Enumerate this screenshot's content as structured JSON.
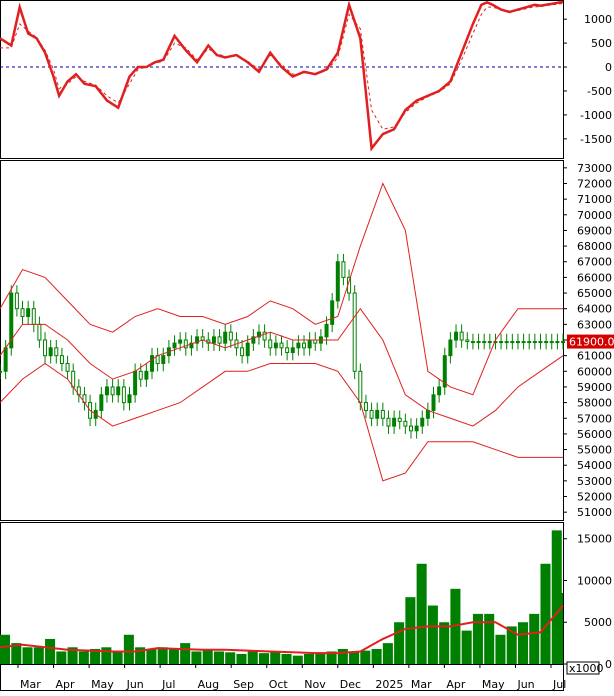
{
  "chart_data": [
    {
      "type": "line",
      "panel": "oscillator",
      "ylim": [
        -1900,
        1400
      ],
      "y_ticks": [
        1000,
        500,
        0,
        -500,
        -1000,
        -1500
      ],
      "zero_line": 0,
      "series": [
        {
          "style": "thick",
          "color": "#e02020",
          "x": [
            0,
            0.02,
            0.035,
            0.05,
            0.065,
            0.08,
            0.095,
            0.105,
            0.12,
            0.135,
            0.15,
            0.17,
            0.19,
            0.21,
            0.23,
            0.245,
            0.26,
            0.275,
            0.29,
            0.31,
            0.33,
            0.35,
            0.37,
            0.385,
            0.4,
            0.42,
            0.44,
            0.46,
            0.48,
            0.5,
            0.52,
            0.54,
            0.56,
            0.58,
            0.6,
            0.62,
            0.64,
            0.66,
            0.68,
            0.7,
            0.72,
            0.74,
            0.76,
            0.78,
            0.8,
            0.82,
            0.84,
            0.855,
            0.865,
            0.875,
            0.89,
            0.905,
            0.92,
            0.935,
            0.95,
            0.96,
            0.97,
            0.98,
            0.99,
            1.0
          ],
          "values": [
            600,
            450,
            1250,
            700,
            600,
            300,
            -200,
            -600,
            -300,
            -150,
            -350,
            -400,
            -700,
            -850,
            -200,
            0,
            0,
            100,
            150,
            650,
            350,
            100,
            450,
            250,
            200,
            250,
            100,
            -100,
            300,
            0,
            -200,
            -100,
            -150,
            -50,
            300,
            1300,
            600,
            -1700,
            -1400,
            -1300,
            -900,
            -700,
            -600,
            -500,
            -300,
            300,
            900,
            1300,
            1350,
            1300,
            1200,
            1150,
            1200,
            1250,
            1300,
            1280,
            1300,
            1320,
            1340,
            1360
          ]
        },
        {
          "style": "dashed",
          "color": "#e02020",
          "x": [
            0,
            0.02,
            0.035,
            0.05,
            0.065,
            0.08,
            0.095,
            0.105,
            0.12,
            0.135,
            0.15,
            0.17,
            0.19,
            0.21,
            0.23,
            0.245,
            0.26,
            0.275,
            0.29,
            0.31,
            0.33,
            0.35,
            0.37,
            0.385,
            0.4,
            0.42,
            0.44,
            0.46,
            0.48,
            0.5,
            0.52,
            0.54,
            0.56,
            0.58,
            0.6,
            0.62,
            0.64,
            0.66,
            0.68,
            0.7,
            0.72,
            0.74,
            0.76,
            0.78,
            0.8,
            0.82,
            0.84,
            0.855,
            0.865,
            0.875,
            0.89,
            0.905,
            0.92,
            0.935,
            0.95,
            0.96,
            0.97,
            0.98,
            0.99,
            1.0
          ],
          "values": [
            400,
            400,
            900,
            750,
            620,
            350,
            -50,
            -450,
            -350,
            -200,
            -300,
            -380,
            -600,
            -750,
            -350,
            -50,
            0,
            80,
            120,
            500,
            400,
            150,
            380,
            280,
            220,
            230,
            120,
            -50,
            250,
            50,
            -150,
            -120,
            -140,
            -80,
            200,
            1100,
            800,
            -900,
            -1300,
            -1250,
            -950,
            -750,
            -620,
            -520,
            -350,
            150,
            700,
            1100,
            1250,
            1250,
            1200,
            1170,
            1180,
            1220,
            1260,
            1260,
            1280,
            1300,
            1310,
            1330
          ]
        }
      ]
    },
    {
      "type": "candlestick",
      "panel": "price",
      "ylim": [
        50500,
        73500
      ],
      "y_ticks": [
        73000,
        72000,
        71000,
        70000,
        69000,
        68000,
        67000,
        66000,
        65000,
        64000,
        63000,
        62000,
        61000,
        60000,
        59000,
        58000,
        57000,
        56000,
        55000,
        54000,
        53000,
        52000,
        51000
      ],
      "last_price_label": "61900.00",
      "last_price": 61900,
      "series": [
        {
          "name": "close",
          "color": "#008000",
          "x": [
            0,
            0.01,
            0.02,
            0.03,
            0.04,
            0.05,
            0.06,
            0.07,
            0.08,
            0.09,
            0.1,
            0.11,
            0.12,
            0.13,
            0.14,
            0.15,
            0.16,
            0.17,
            0.18,
            0.19,
            0.2,
            0.21,
            0.22,
            0.23,
            0.24,
            0.25,
            0.26,
            0.27,
            0.28,
            0.29,
            0.3,
            0.31,
            0.32,
            0.33,
            0.34,
            0.35,
            0.36,
            0.37,
            0.38,
            0.39,
            0.4,
            0.41,
            0.42,
            0.43,
            0.44,
            0.45,
            0.46,
            0.47,
            0.48,
            0.49,
            0.5,
            0.51,
            0.52,
            0.53,
            0.54,
            0.55,
            0.56,
            0.57,
            0.58,
            0.59,
            0.6,
            0.61,
            0.62,
            0.63,
            0.64,
            0.65,
            0.66,
            0.67,
            0.68,
            0.69,
            0.7,
            0.71,
            0.72,
            0.73,
            0.74,
            0.75,
            0.76,
            0.77,
            0.78,
            0.79,
            0.8,
            0.81,
            0.82,
            0.83,
            0.84,
            0.85,
            0.86,
            0.87,
            0.88,
            0.89,
            0.9,
            0.91,
            0.92,
            0.93,
            0.94,
            0.95,
            0.96,
            0.97,
            0.98,
            0.99,
            1.0
          ],
          "values": [
            60000,
            61500,
            65000,
            64000,
            63500,
            64000,
            63000,
            62000,
            61000,
            61500,
            61000,
            60500,
            60000,
            59000,
            58500,
            58000,
            57000,
            57500,
            58500,
            59000,
            58500,
            59000,
            58000,
            58500,
            60000,
            59500,
            60000,
            61000,
            60500,
            61000,
            61500,
            61800,
            62000,
            61500,
            61800,
            62200,
            62000,
            61800,
            62200,
            61800,
            62500,
            62000,
            61500,
            61000,
            61800,
            62200,
            62500,
            62000,
            61500,
            61800,
            61500,
            61200,
            61500,
            61800,
            61500,
            62000,
            61800,
            62200,
            63000,
            64500,
            67000,
            66000,
            65000,
            60000,
            58000,
            57500,
            57000,
            57500,
            57000,
            56500,
            57000,
            56800,
            56500,
            56200,
            56500,
            57000,
            57500,
            58500,
            59000,
            61000,
            62000,
            62500,
            62000,
            61900,
            61900,
            61900,
            61900,
            61900,
            61900,
            61900,
            61900,
            61900,
            61900,
            61900,
            61900,
            61900,
            61900,
            61900,
            61900,
            61900,
            61900
          ]
        },
        {
          "name": "upper band",
          "color": "#e02020",
          "x": [
            0,
            0.04,
            0.08,
            0.12,
            0.16,
            0.2,
            0.24,
            0.28,
            0.32,
            0.36,
            0.4,
            0.44,
            0.48,
            0.52,
            0.56,
            0.6,
            0.64,
            0.68,
            0.72,
            0.76,
            0.8,
            0.84,
            0.88,
            0.92,
            0.96,
            1.0
          ],
          "values": [
            64000,
            66500,
            66000,
            64500,
            63000,
            62500,
            63500,
            64000,
            63500,
            63500,
            63000,
            63500,
            64500,
            64000,
            63000,
            63500,
            68000,
            72000,
            69000,
            60000,
            59000,
            58500,
            62000,
            64000,
            64000,
            64000
          ]
        },
        {
          "name": "lower band",
          "color": "#e02020",
          "x": [
            0,
            0.04,
            0.08,
            0.12,
            0.16,
            0.2,
            0.24,
            0.28,
            0.32,
            0.36,
            0.4,
            0.44,
            0.48,
            0.52,
            0.56,
            0.6,
            0.64,
            0.68,
            0.72,
            0.76,
            0.8,
            0.84,
            0.88,
            0.92,
            0.96,
            1.0
          ],
          "values": [
            58000,
            59500,
            60500,
            59500,
            57500,
            56500,
            57000,
            57500,
            58000,
            59000,
            60000,
            60000,
            60500,
            60500,
            60500,
            60000,
            58000,
            53000,
            53500,
            55500,
            55500,
            55500,
            55000,
            54500,
            54500,
            54500
          ]
        },
        {
          "name": "middle band",
          "color": "#e02020",
          "x": [
            0,
            0.04,
            0.08,
            0.12,
            0.16,
            0.2,
            0.24,
            0.28,
            0.32,
            0.36,
            0.4,
            0.44,
            0.48,
            0.52,
            0.56,
            0.6,
            0.64,
            0.68,
            0.72,
            0.76,
            0.8,
            0.84,
            0.88,
            0.92,
            0.96,
            1.0
          ],
          "values": [
            61000,
            63000,
            63000,
            62000,
            60500,
            59500,
            60000,
            61000,
            61500,
            62000,
            61500,
            62000,
            62500,
            62000,
            62000,
            62000,
            64000,
            62000,
            58500,
            57500,
            57000,
            56500,
            57500,
            59000,
            60000,
            61000
          ]
        }
      ]
    },
    {
      "type": "bar",
      "panel": "volume",
      "ylim": [
        0,
        17000
      ],
      "y_ticks": [
        15000,
        10000,
        5000,
        0
      ],
      "unit_label": "x1000",
      "x_tick_labels": [
        "Mar",
        "Apr",
        "May",
        "Jun",
        "Jul",
        "Aug",
        "Sep",
        "Oct",
        "Nov",
        "Dec",
        "2025",
        "Mar",
        "Apr",
        "May",
        "Jun",
        "Jul"
      ],
      "series": [
        {
          "name": "volume",
          "color": "#008000",
          "x": [
            0,
            0.02,
            0.04,
            0.06,
            0.08,
            0.1,
            0.12,
            0.14,
            0.16,
            0.18,
            0.2,
            0.22,
            0.24,
            0.26,
            0.28,
            0.3,
            0.32,
            0.34,
            0.36,
            0.38,
            0.4,
            0.42,
            0.44,
            0.46,
            0.48,
            0.5,
            0.52,
            0.54,
            0.56,
            0.58,
            0.6,
            0.62,
            0.64,
            0.66,
            0.68,
            0.7,
            0.72,
            0.74,
            0.76,
            0.78,
            0.8,
            0.82,
            0.84,
            0.86,
            0.88,
            0.9,
            0.92,
            0.94,
            0.96,
            0.98,
            1.0
          ],
          "values": [
            3500,
            2500,
            2000,
            2000,
            3000,
            1500,
            2000,
            1500,
            1800,
            2000,
            1500,
            3500,
            2000,
            1800,
            2000,
            1800,
            2500,
            1500,
            1800,
            1500,
            1400,
            1200,
            1500,
            1300,
            1500,
            1200,
            1000,
            1200,
            1400,
            1500,
            1800,
            1500,
            1600,
            1800,
            2500,
            5000,
            8000,
            12000,
            7000,
            5000,
            9000,
            4000,
            6000,
            6000,
            3500,
            4500,
            5000,
            6000,
            12000,
            16000,
            8500
          ]
        },
        {
          "name": "volume average",
          "color": "#e02020",
          "x": [
            0,
            0.04,
            0.08,
            0.12,
            0.16,
            0.2,
            0.24,
            0.28,
            0.32,
            0.36,
            0.4,
            0.44,
            0.48,
            0.52,
            0.56,
            0.6,
            0.64,
            0.68,
            0.72,
            0.76,
            0.8,
            0.84,
            0.88,
            0.92,
            0.96,
            1.0
          ],
          "values": [
            2000,
            2300,
            2000,
            1700,
            1600,
            1500,
            1500,
            1900,
            1800,
            1700,
            1700,
            1600,
            1500,
            1400,
            1300,
            1300,
            1500,
            3000,
            4200,
            4500,
            4500,
            5000,
            5000,
            3500,
            3800,
            7000
          ]
        }
      ]
    }
  ]
}
